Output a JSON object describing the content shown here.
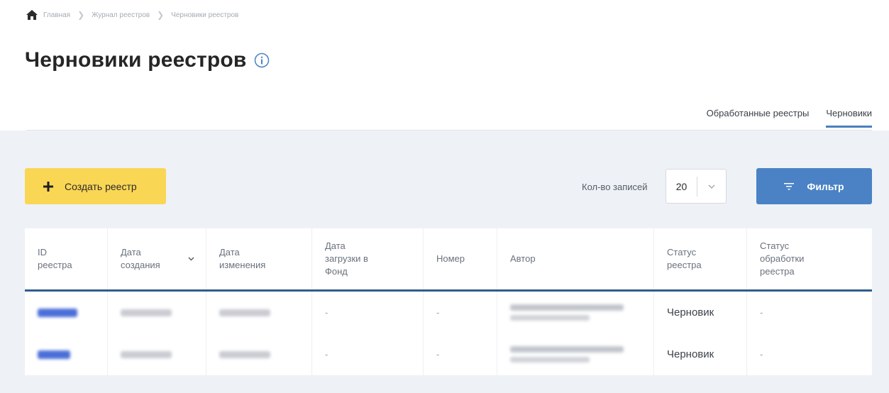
{
  "breadcrumb": {
    "home": "Главная",
    "journal": "Журнал реестров",
    "current": "Черновики реестров"
  },
  "page": {
    "title": "Черновики реестров"
  },
  "tabs": {
    "processed": "Обработанные реестры",
    "drafts": "Черновики"
  },
  "toolbar": {
    "create_label": "Создать реестр",
    "count_label": "Кол-во записей",
    "count_value": "20",
    "filter_label": "Фильтр"
  },
  "table": {
    "headers": {
      "id": [
        "ID",
        "реестра"
      ],
      "created": [
        "Дата",
        "создания"
      ],
      "changed": [
        "Дата",
        "изменения"
      ],
      "uploaded": [
        "Дата",
        "загрузки в",
        "Фонд"
      ],
      "number": [
        "Номер"
      ],
      "author": [
        "Автор"
      ],
      "status": [
        "Статус",
        "реестра"
      ],
      "processing": [
        "Статус",
        "обработки",
        "реестра"
      ]
    },
    "rows": [
      {
        "uploaded": "-",
        "number": "-",
        "status": "Черновик",
        "processing": "-"
      },
      {
        "uploaded": "-",
        "number": "-",
        "status": "Черновик",
        "processing": "-"
      }
    ]
  },
  "colors": {
    "create_button": "#fad655",
    "filter_button": "#4a82c5",
    "active_tab_underline": "#4a7fbe",
    "table_header_rule": "#2f5d8c",
    "panel_background": "#eef2f6"
  },
  "icons": {
    "home": "home-icon",
    "info": "info-icon",
    "plus": "plus-icon",
    "filter": "filter-icon",
    "chevron": "chevron-down-icon",
    "sort": "sort-down-icon"
  }
}
